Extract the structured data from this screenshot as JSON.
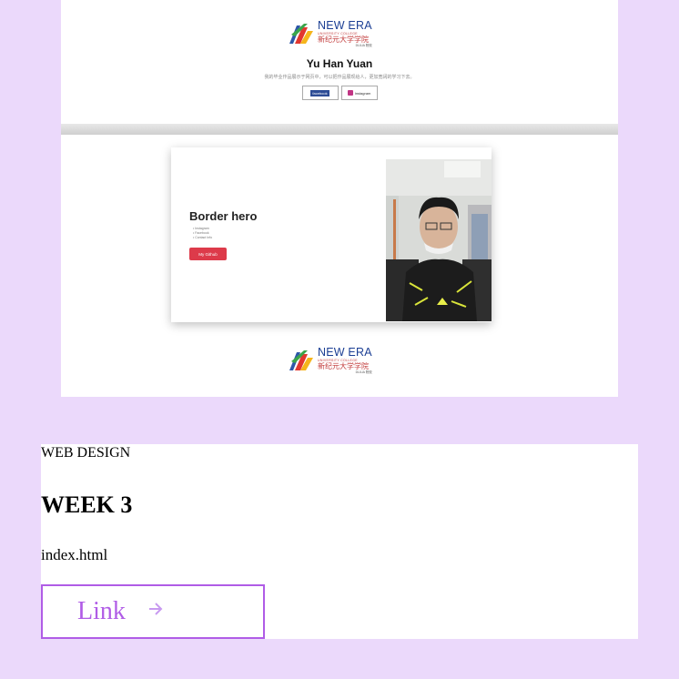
{
  "preview": {
    "logo": {
      "line1": "NEW ERA",
      "line2": "UNIVERSITY COLLEGE",
      "line3": "新纪元大学学院",
      "line4": "DULIA 院校"
    },
    "name": "Yu Han Yuan",
    "subtitle": "我的毕业作品展示于网页中，可以把作品展现给人，更加宽阔的学习下去。",
    "buttons": {
      "facebook": "facebook",
      "instagram": "Instagram"
    },
    "hero": {
      "title": "Border hero",
      "list": [
        "• Instagram",
        "• Facebook",
        "• Contact Info"
      ],
      "button": "My Github"
    }
  },
  "card": {
    "kicker": "WEB DESIGN",
    "title": "WEEK 3",
    "file": "index.html",
    "link_label": "Link",
    "accent": "#b05ce6"
  }
}
